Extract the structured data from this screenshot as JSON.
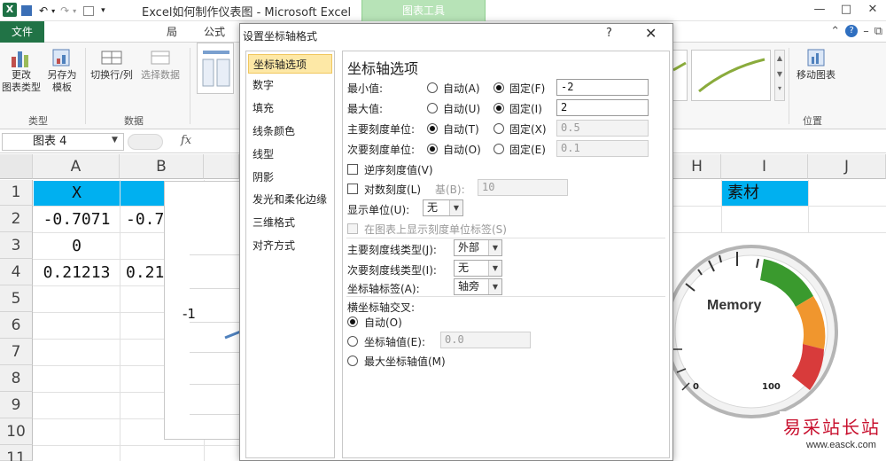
{
  "window": {
    "title": "Excel如何制作仪表图 - Microsoft Excel",
    "context_tab": "图表工具",
    "controls": [
      "—",
      "□",
      "✕"
    ]
  },
  "ribbon_tabs": {
    "file": "文件",
    "visible": [
      "局",
      "公式"
    ]
  },
  "ribbon": {
    "buttons": {
      "change_type": "更改\n图表类型",
      "save_template": "另存为\n模板",
      "switch_rowcol": "切换行/列",
      "select_data": "选择数据",
      "move_chart": "移动图表"
    },
    "groups": {
      "type": "类型",
      "data": "数据",
      "position": "位置"
    }
  },
  "formula_bar": {
    "name_box": "图表 4",
    "fx": "fx"
  },
  "grid": {
    "columns": [
      "A",
      "B",
      "H",
      "I",
      "J"
    ],
    "rows": [
      "1",
      "2",
      "3",
      "4",
      "5",
      "6",
      "7",
      "8",
      "9",
      "10",
      "11"
    ],
    "cells": {
      "A1": "X",
      "A2": "-0.7071",
      "A3": "0",
      "A4": "0.21213",
      "B2": "-0.7",
      "B4": "0.21",
      "I1": "素材"
    },
    "chart_label": "-1",
    "header_fill": "#00b0f0"
  },
  "gauge": {
    "label": "Memory",
    "min_label": "0",
    "max_label": "100",
    "colors": [
      "#3a9a2e",
      "#f0962e",
      "#d83b3b"
    ]
  },
  "watermark": {
    "main": "易采站长站",
    "url": "www.easck.com"
  },
  "dialog": {
    "title": "设置坐标轴格式",
    "help": "?",
    "close": "✕",
    "nav": [
      "坐标轴选项",
      "数字",
      "填充",
      "线条颜色",
      "线型",
      "阴影",
      "发光和柔化边缘",
      "三维格式",
      "对齐方式"
    ],
    "panel_title": "坐标轴选项",
    "min": {
      "label": "最小值:",
      "auto": "自动(A)",
      "fixed": "固定(F)",
      "value": "-2"
    },
    "max": {
      "label": "最大值:",
      "auto": "自动(U)",
      "fixed": "固定(I)",
      "value": "2"
    },
    "major": {
      "label": "主要刻度单位:",
      "auto": "自动(T)",
      "fixed": "固定(X)",
      "value": "0.5"
    },
    "minor": {
      "label": "次要刻度单位:",
      "auto": "自动(O)",
      "fixed": "固定(E)",
      "value": "0.1"
    },
    "reverse": "逆序刻度值(V)",
    "log": {
      "label": "对数刻度(L)",
      "base_label": "基(B):",
      "base": "10"
    },
    "display_units": {
      "label": "显示单位(U):",
      "value": "无"
    },
    "show_units_label": "在图表上显示刻度单位标签(S)",
    "major_tick": {
      "label": "主要刻度线类型(J):",
      "value": "外部"
    },
    "minor_tick": {
      "label": "次要刻度线类型(I):",
      "value": "无"
    },
    "axis_labels": {
      "label": "坐标轴标签(A):",
      "value": "轴旁"
    },
    "cross": {
      "label": "横坐标轴交叉:",
      "auto": "自动(O)",
      "at_value": "坐标轴值(E):",
      "at_value_input": "0.0",
      "max": "最大坐标轴值(M)"
    }
  }
}
